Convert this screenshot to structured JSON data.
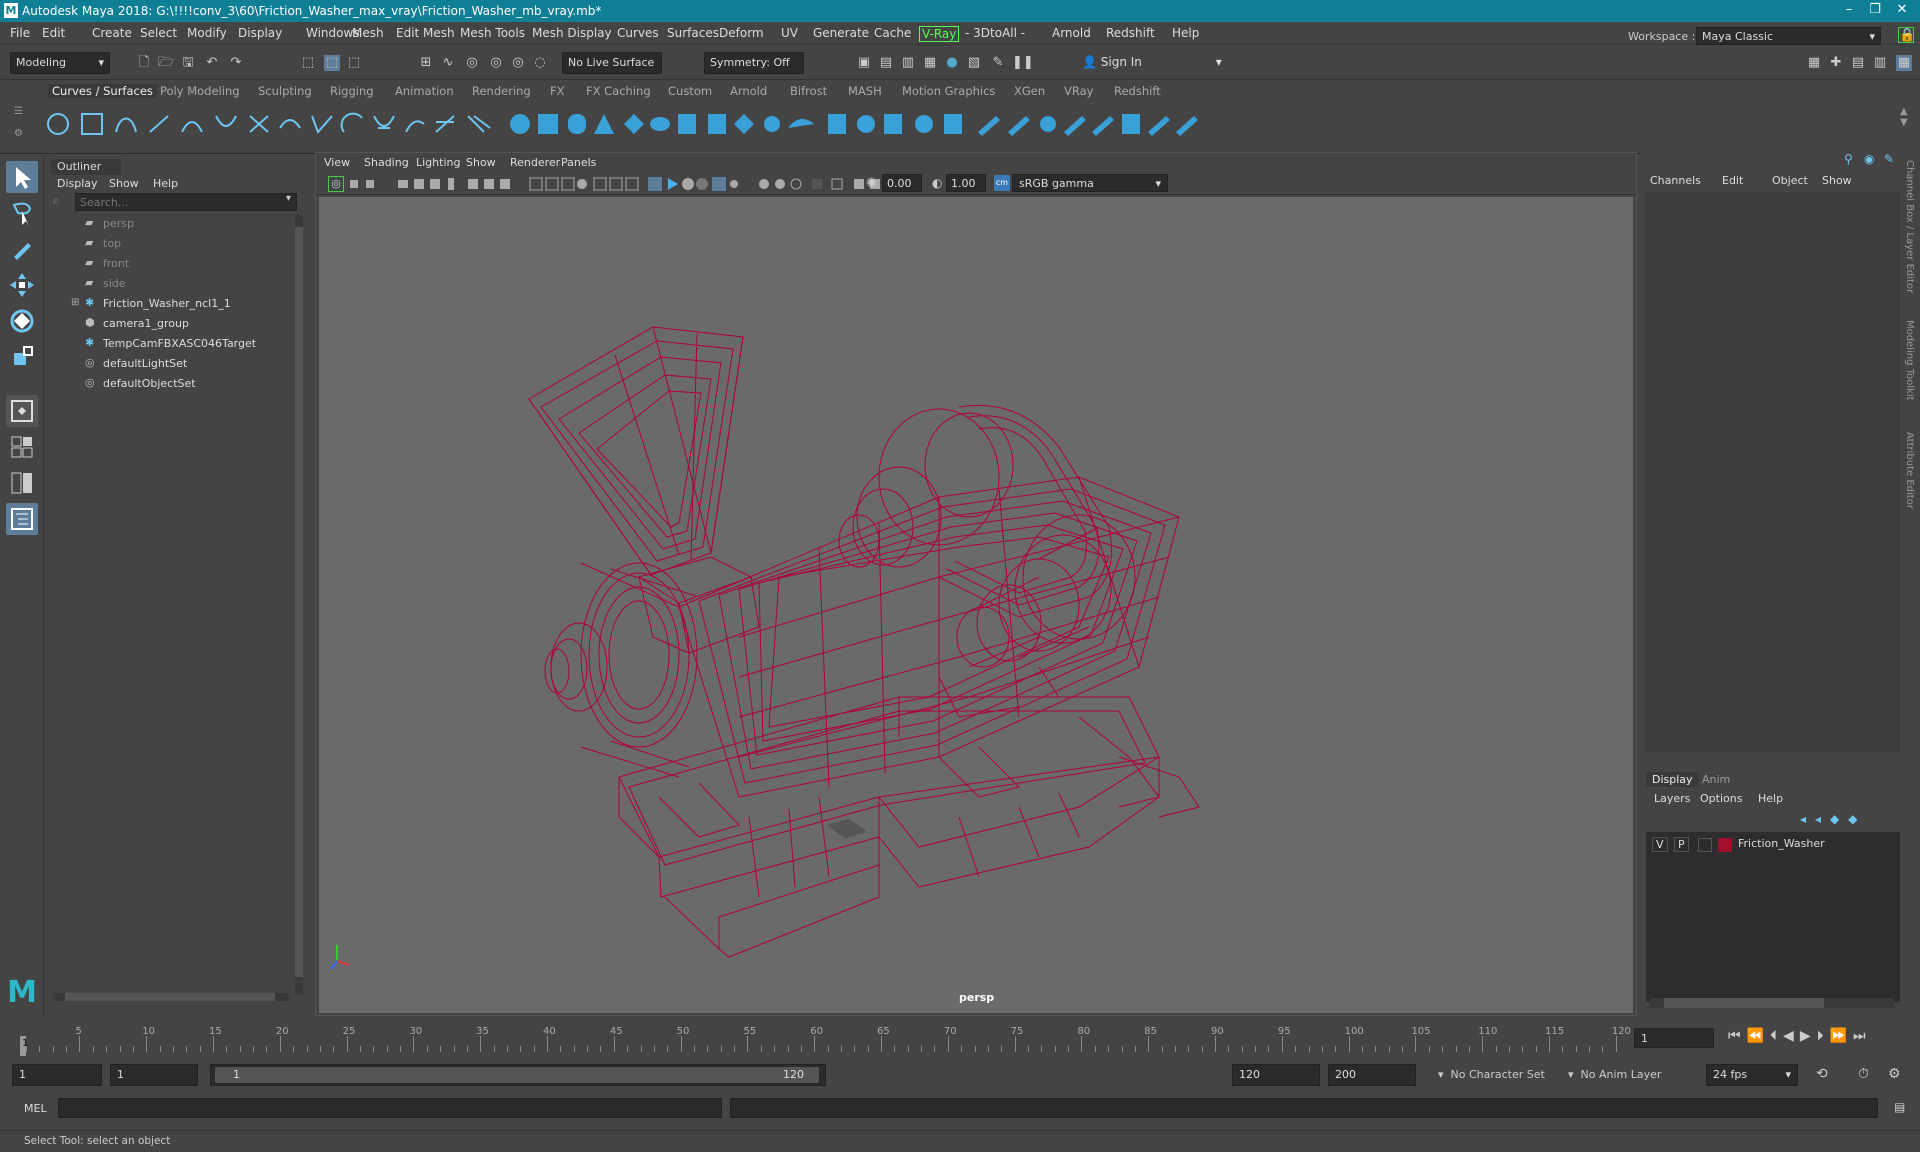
{
  "window": {
    "title": "Autodesk Maya 2018: G:\\!!!!conv_3\\60\\Friction_Washer_max_vray\\Friction_Washer_mb_vray.mb*",
    "logo": "M"
  },
  "menus": [
    "File",
    "Edit",
    "Create",
    "Select",
    "Modify",
    "Display",
    "Windows",
    "Mesh",
    "Edit Mesh",
    "Mesh Tools",
    "Mesh Display",
    "Curves",
    "Surfaces",
    "Deform",
    "UV",
    "Generate",
    "Cache",
    "V-Ray",
    "- 3DtoAll -",
    "Arnold",
    "Redshift",
    "Help"
  ],
  "workspace": {
    "label": "Workspace :",
    "value": "Maya Classic"
  },
  "status": {
    "mode": "Modeling",
    "live_surface": "No Live Surface",
    "symmetry": "Symmetry: Off",
    "sign_in": "Sign In"
  },
  "shelf_tabs": [
    "Curves / Surfaces",
    "Poly Modeling",
    "Sculpting",
    "Rigging",
    "Animation",
    "Rendering",
    "FX",
    "FX Caching",
    "Custom",
    "Arnold",
    "Bifrost",
    "MASH",
    "Motion Graphics",
    "XGen",
    "VRay",
    "Redshift"
  ],
  "outliner": {
    "title": "Outliner",
    "menu": [
      "Display",
      "Show",
      "Help"
    ],
    "search_placeholder": "Search...",
    "items": [
      {
        "label": "persp",
        "icon": "camera-icon",
        "dim": true
      },
      {
        "label": "top",
        "icon": "camera-icon",
        "dim": true
      },
      {
        "label": "front",
        "icon": "camera-icon",
        "dim": true
      },
      {
        "label": "side",
        "icon": "camera-icon",
        "dim": true
      },
      {
        "label": "Friction_Washer_ncl1_1",
        "icon": "transform-icon",
        "dim": false
      },
      {
        "label": "camera1_group",
        "icon": "group-icon",
        "dim": false
      },
      {
        "label": "TempCamFBXASC046Target",
        "icon": "transform-icon",
        "dim": false
      },
      {
        "label": "defaultLightSet",
        "icon": "set-icon",
        "dim": false
      },
      {
        "label": "defaultObjectSet",
        "icon": "set-icon",
        "dim": false
      }
    ]
  },
  "viewport": {
    "menu": [
      "View",
      "Shading",
      "Lighting",
      "Show",
      "Renderer",
      "Panels"
    ],
    "exposure": "0.00",
    "gamma": "1.00",
    "colorspace": "sRGB gamma",
    "camera_label": "persp",
    "wire_color": "#b0003a"
  },
  "channelbox": {
    "menu": [
      "Channels",
      "Edit",
      "Object",
      "Show"
    ],
    "side_tabs": [
      "Channel Box / Layer Editor",
      "Modeling Toolkit",
      "Attribute Editor"
    ]
  },
  "layers": {
    "tabs": [
      "Display",
      "Anim"
    ],
    "menu": [
      "Layers",
      "Options",
      "Help"
    ],
    "rows": [
      {
        "v": "V",
        "p": "P",
        "name": "Friction_Washer",
        "color": "#a0102e"
      }
    ]
  },
  "timeline": {
    "ticks": [
      "5",
      "10",
      "15",
      "20",
      "25",
      "30",
      "35",
      "40",
      "45",
      "50",
      "55",
      "60",
      "65",
      "70",
      "75",
      "80",
      "85",
      "90",
      "95",
      "100",
      "105",
      "110",
      "115",
      "120"
    ],
    "current_frame": "1",
    "start_label": "1"
  },
  "range": {
    "start": "1",
    "inner_start": "1",
    "slider_start": "1",
    "slider_end": "120",
    "end": "120",
    "outer_end": "200",
    "character": "No Character Set",
    "anim_layer": "No Anim Layer",
    "fps": "24 fps"
  },
  "cmd": {
    "label": "MEL"
  },
  "help": {
    "text": "Select Tool: select an object"
  }
}
